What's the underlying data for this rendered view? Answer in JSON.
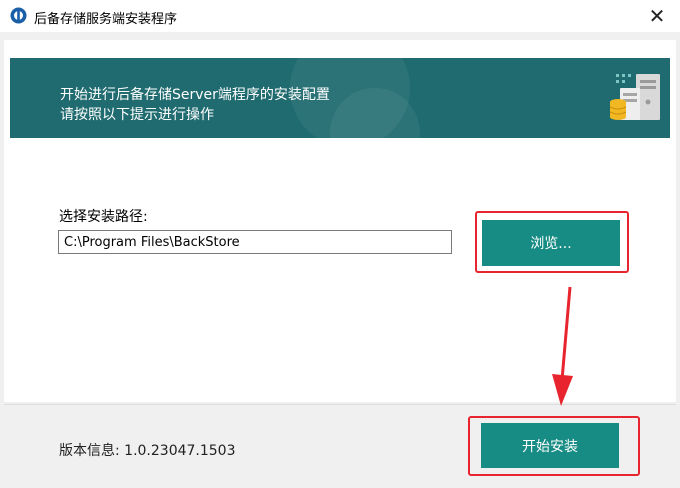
{
  "window": {
    "title": "后备存储服务端安装程序",
    "close_glyph": "✕"
  },
  "banner": {
    "line1": "开始进行后备存储Server端程序的安装配置",
    "line2": "请按照以下提示进行操作",
    "background_color": "#1f6b6f",
    "icon": "server-database-icon"
  },
  "install_path": {
    "label": "选择安装路径:",
    "value": "C:\\Program Files\\BackStore"
  },
  "buttons": {
    "browse_label": "浏览...",
    "install_label": "开始安装",
    "color": "#178c84"
  },
  "footer": {
    "version_text": "版本信息:  1.0.23047.1503"
  },
  "annotations": {
    "highlight_color": "#e8252e"
  }
}
